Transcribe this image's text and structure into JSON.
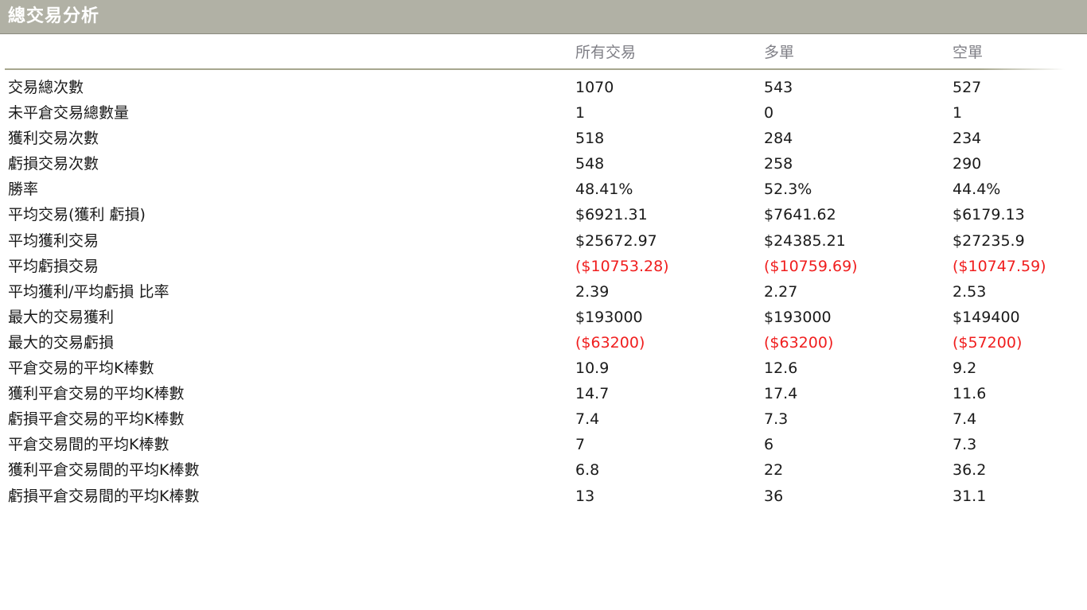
{
  "title": "總交易分析",
  "columns": [
    "所有交易",
    "多單",
    "空單"
  ],
  "colors": {
    "title_bar": "#b1b1a5",
    "header_text": "#7f7f86",
    "negative": "#f01e1e"
  },
  "rows": [
    {
      "label": "交易總次數",
      "values": [
        "1070",
        "543",
        "527"
      ],
      "negative": false
    },
    {
      "label": "未平倉交易總數量",
      "values": [
        "1",
        "0",
        "1"
      ],
      "negative": false
    },
    {
      "label": "獲利交易次數",
      "values": [
        "518",
        "284",
        "234"
      ],
      "negative": false
    },
    {
      "label": "虧損交易次數",
      "values": [
        "548",
        "258",
        "290"
      ],
      "negative": false
    },
    {
      "label": "勝率",
      "values": [
        "48.41%",
        "52.3%",
        "44.4%"
      ],
      "negative": false
    },
    {
      "label": "平均交易(獲利  虧損)",
      "values": [
        "$6921.31",
        "$7641.62",
        "$6179.13"
      ],
      "negative": false
    },
    {
      "label": "平均獲利交易",
      "values": [
        "$25672.97",
        "$24385.21",
        "$27235.9"
      ],
      "negative": false
    },
    {
      "label": "平均虧損交易",
      "values": [
        "($10753.28)",
        "($10759.69)",
        "($10747.59)"
      ],
      "negative": true
    },
    {
      "label": "平均獲利/平均虧損  比率",
      "values": [
        "2.39",
        "2.27",
        "2.53"
      ],
      "negative": false
    },
    {
      "label": "最大的交易獲利",
      "values": [
        "$193000",
        "$193000",
        "$149400"
      ],
      "negative": false
    },
    {
      "label": "最大的交易虧損",
      "values": [
        "($63200)",
        "($63200)",
        "($57200)"
      ],
      "negative": true
    },
    {
      "label": "平倉交易的平均K棒數",
      "values": [
        "10.9",
        "12.6",
        "9.2"
      ],
      "negative": false
    },
    {
      "label": "獲利平倉交易的平均K棒數",
      "values": [
        "14.7",
        "17.4",
        "11.6"
      ],
      "negative": false
    },
    {
      "label": "虧損平倉交易的平均K棒數",
      "values": [
        "7.4",
        "7.3",
        "7.4"
      ],
      "negative": false
    },
    {
      "label": "平倉交易間的平均K棒數",
      "values": [
        "7",
        "6",
        "7.3"
      ],
      "negative": false
    },
    {
      "label": "獲利平倉交易間的平均K棒數",
      "values": [
        "6.8",
        "22",
        "36.2"
      ],
      "negative": false
    },
    {
      "label": "虧損平倉交易間的平均K棒數",
      "values": [
        "13",
        "36",
        "31.1"
      ],
      "negative": false
    }
  ]
}
